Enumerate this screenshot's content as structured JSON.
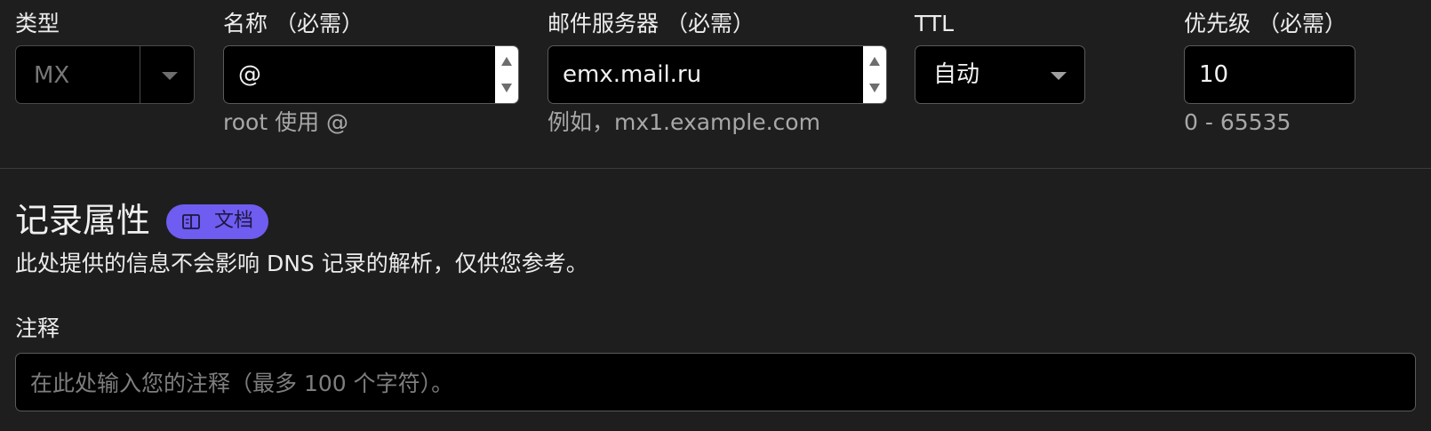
{
  "fields": {
    "type": {
      "label": "类型",
      "value": "MX"
    },
    "name": {
      "label": "名称 （必需）",
      "value": "@",
      "hint": "root 使用 @"
    },
    "mail_server": {
      "label": "邮件服务器 （必需）",
      "value": "emx.mail.ru",
      "hint": "例如，mx1.example.com"
    },
    "ttl": {
      "label": "TTL",
      "value": "自动"
    },
    "priority": {
      "label": "优先级 （必需）",
      "value": "10",
      "hint": "0 - 65535"
    }
  },
  "record_attributes": {
    "title": "记录属性",
    "docs_badge": {
      "label": "文档",
      "icon": "book-icon",
      "color": "#6f5cf0"
    },
    "description": "此处提供的信息不会影响 DNS 记录的解析，仅供您参考。"
  },
  "comment": {
    "label": "注释",
    "placeholder": "在此处输入您的注释（最多 100 个字符）。"
  }
}
